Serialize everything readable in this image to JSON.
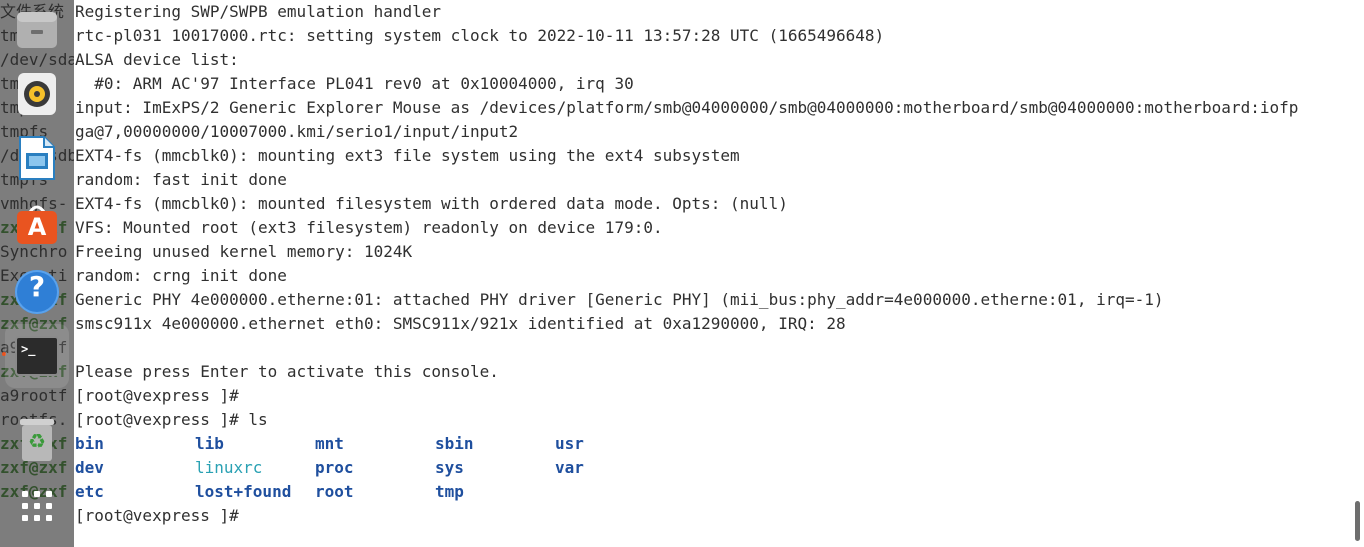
{
  "background_terminal": {
    "lines": [
      {
        "text": "文件系统",
        "prompt": false
      },
      {
        "text": "tmpfs",
        "prompt": false
      },
      {
        "text": "/dev/sda",
        "prompt": false
      },
      {
        "text": "tmpfs",
        "prompt": false
      },
      {
        "text": "tmpfs",
        "prompt": false
      },
      {
        "text": "tmpfs",
        "prompt": false
      },
      {
        "text": "/dev/sdb",
        "prompt": false
      },
      {
        "text": "tmpfs",
        "prompt": false
      },
      {
        "text": "vmhgfs-",
        "prompt": false
      },
      {
        "text": "zxf@zxf",
        "prompt": true
      },
      {
        "text": "Synchro",
        "prompt": false
      },
      {
        "text": "Executi",
        "prompt": false
      },
      {
        "text": "zxf@zxf",
        "prompt": true
      },
      {
        "text": "zxf@zxf",
        "prompt": true
      },
      {
        "text": "a9rootf",
        "prompt": false
      },
      {
        "text": "zxf@zxf",
        "prompt": true
      },
      {
        "text": "a9rootf",
        "prompt": false
      },
      {
        "text": "rootfs.",
        "prompt": false
      },
      {
        "text": "zxf@zxf",
        "prompt": true
      },
      {
        "text": "zxf@zxf",
        "prompt": true
      },
      {
        "text": "zxf@zxf",
        "prompt": true
      }
    ]
  },
  "dock": {
    "items": [
      {
        "name": "files",
        "icon": "file-cabinet-icon"
      },
      {
        "name": "rhythmbox",
        "icon": "speaker-icon"
      },
      {
        "name": "libreoffice-impress",
        "icon": "presentation-icon"
      },
      {
        "name": "ubuntu-software",
        "icon": "shopping-bag-icon",
        "glyph": "A"
      },
      {
        "name": "help",
        "icon": "help-icon",
        "glyph": "?"
      },
      {
        "name": "terminal",
        "icon": "terminal-icon",
        "glyph": ">_"
      },
      {
        "name": "trash",
        "icon": "trash-icon",
        "glyph": "♻"
      },
      {
        "name": "show-applications",
        "icon": "app-grid-icon"
      }
    ],
    "accent_color": "#e95420"
  },
  "terminal": {
    "lines": [
      "Registering SWP/SWPB emulation handler",
      "rtc-pl031 10017000.rtc: setting system clock to 2022-10-11 13:57:28 UTC (1665496648)",
      "ALSA device list:",
      "  #0: ARM AC'97 Interface PL041 rev0 at 0x10004000, irq 30",
      "input: ImExPS/2 Generic Explorer Mouse as /devices/platform/smb@04000000/smb@04000000:motherboard/smb@04000000:motherboard:iofp",
      "ga@7,00000000/10007000.kmi/serio1/input/input2",
      "EXT4-fs (mmcblk0): mounting ext3 file system using the ext4 subsystem",
      "random: fast init done",
      "EXT4-fs (mmcblk0): mounted filesystem with ordered data mode. Opts: (null)",
      "VFS: Mounted root (ext3 filesystem) readonly on device 179:0.",
      "Freeing unused kernel memory: 1024K",
      "random: crng init done",
      "Generic PHY 4e000000.etherne:01: attached PHY driver [Generic PHY] (mii_bus:phy_addr=4e000000.etherne:01, irq=-1)",
      "smsc911x 4e000000.ethernet eth0: SMSC911x/921x identified at 0xa1290000, IRQ: 28",
      "",
      "Please press Enter to activate this console.",
      "[root@vexpress ]#",
      "[root@vexpress ]# ls"
    ],
    "ls_output": [
      [
        "bin",
        "lib",
        "mnt",
        "sbin",
        "usr"
      ],
      [
        "dev",
        "linuxrc",
        "proc",
        "sys",
        "var"
      ],
      [
        "etc",
        "lost+found",
        "root",
        "tmp",
        ""
      ]
    ],
    "ls_symlinks": [
      "linuxrc"
    ],
    "final_prompt": "[root@vexpress ]#",
    "colors": {
      "text": "#303030",
      "directory": "#1f4f9e",
      "symlink": "#2aa1b3"
    }
  }
}
